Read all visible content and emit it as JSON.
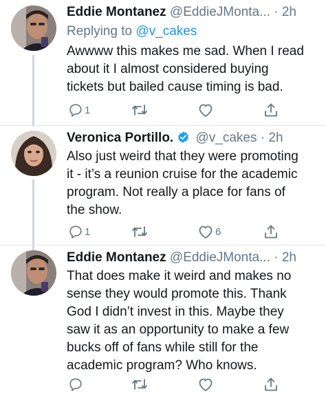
{
  "colors": {
    "text": "#14171a",
    "muted": "#657786",
    "link": "#1b95e0",
    "verified": "#1da1f2",
    "divider": "#e1e8ed"
  },
  "tweets": [
    {
      "name": "Eddie Montanez",
      "handle": "@EddieJMonta...",
      "separator": "·",
      "time": "2h",
      "replying_prefix": "Replying to",
      "replying_to": "@v_cakes",
      "lines": [
        "Awwww this makes me sad. When I read",
        "about it I almost considered buying",
        "tickets but bailed cause timing is bad."
      ],
      "reply_count": "1",
      "retweet_count": "",
      "like_count": ""
    },
    {
      "name": "Veronica Portillo.",
      "verified_icon": "verified-badge-icon",
      "handle": "@v_cakes",
      "separator": "·",
      "time": "2h",
      "lines": [
        "Also just weird that they were promoting",
        "it - it’s a reunion cruise for the academic",
        "program.  Not really a place for fans of",
        "the show."
      ],
      "reply_count": "1",
      "retweet_count": "",
      "like_count": "6"
    },
    {
      "name": "Eddie Montanez",
      "handle": "@EddieJMonta...",
      "separator": "·",
      "time": "2h",
      "lines": [
        "That does make it weird and makes no",
        "sense they would promote this. Thank",
        "God I didn’t invest in this. Maybe they",
        "saw it as an opportunity to make a few",
        "bucks off of fans while still for the",
        "academic program? Who knows."
      ],
      "reply_count": "",
      "retweet_count": "",
      "like_count": ""
    }
  ],
  "icons": {
    "reply": "reply-icon",
    "retweet": "retweet-icon",
    "like": "heart-icon",
    "share": "share-icon"
  }
}
